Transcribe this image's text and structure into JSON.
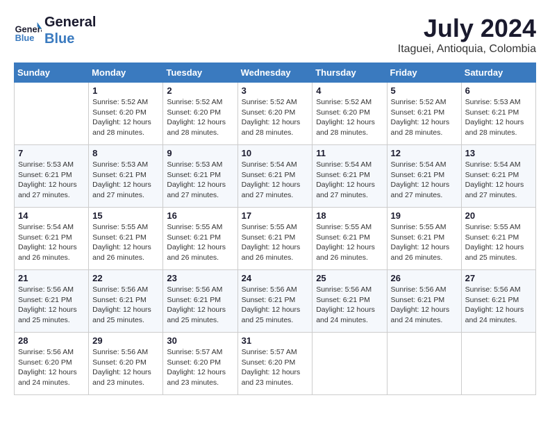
{
  "header": {
    "logo_line1": "General",
    "logo_line2": "Blue",
    "month_year": "July 2024",
    "location": "Itaguei, Antioquia, Colombia"
  },
  "days_of_week": [
    "Sunday",
    "Monday",
    "Tuesday",
    "Wednesday",
    "Thursday",
    "Friday",
    "Saturday"
  ],
  "weeks": [
    [
      {
        "day": "",
        "info": ""
      },
      {
        "day": "1",
        "info": "Sunrise: 5:52 AM\nSunset: 6:20 PM\nDaylight: 12 hours\nand 28 minutes."
      },
      {
        "day": "2",
        "info": "Sunrise: 5:52 AM\nSunset: 6:20 PM\nDaylight: 12 hours\nand 28 minutes."
      },
      {
        "day": "3",
        "info": "Sunrise: 5:52 AM\nSunset: 6:20 PM\nDaylight: 12 hours\nand 28 minutes."
      },
      {
        "day": "4",
        "info": "Sunrise: 5:52 AM\nSunset: 6:20 PM\nDaylight: 12 hours\nand 28 minutes."
      },
      {
        "day": "5",
        "info": "Sunrise: 5:52 AM\nSunset: 6:21 PM\nDaylight: 12 hours\nand 28 minutes."
      },
      {
        "day": "6",
        "info": "Sunrise: 5:53 AM\nSunset: 6:21 PM\nDaylight: 12 hours\nand 28 minutes."
      }
    ],
    [
      {
        "day": "7",
        "info": "Sunrise: 5:53 AM\nSunset: 6:21 PM\nDaylight: 12 hours\nand 27 minutes."
      },
      {
        "day": "8",
        "info": "Sunrise: 5:53 AM\nSunset: 6:21 PM\nDaylight: 12 hours\nand 27 minutes."
      },
      {
        "day": "9",
        "info": "Sunrise: 5:53 AM\nSunset: 6:21 PM\nDaylight: 12 hours\nand 27 minutes."
      },
      {
        "day": "10",
        "info": "Sunrise: 5:54 AM\nSunset: 6:21 PM\nDaylight: 12 hours\nand 27 minutes."
      },
      {
        "day": "11",
        "info": "Sunrise: 5:54 AM\nSunset: 6:21 PM\nDaylight: 12 hours\nand 27 minutes."
      },
      {
        "day": "12",
        "info": "Sunrise: 5:54 AM\nSunset: 6:21 PM\nDaylight: 12 hours\nand 27 minutes."
      },
      {
        "day": "13",
        "info": "Sunrise: 5:54 AM\nSunset: 6:21 PM\nDaylight: 12 hours\nand 27 minutes."
      }
    ],
    [
      {
        "day": "14",
        "info": "Sunrise: 5:54 AM\nSunset: 6:21 PM\nDaylight: 12 hours\nand 26 minutes."
      },
      {
        "day": "15",
        "info": "Sunrise: 5:55 AM\nSunset: 6:21 PM\nDaylight: 12 hours\nand 26 minutes."
      },
      {
        "day": "16",
        "info": "Sunrise: 5:55 AM\nSunset: 6:21 PM\nDaylight: 12 hours\nand 26 minutes."
      },
      {
        "day": "17",
        "info": "Sunrise: 5:55 AM\nSunset: 6:21 PM\nDaylight: 12 hours\nand 26 minutes."
      },
      {
        "day": "18",
        "info": "Sunrise: 5:55 AM\nSunset: 6:21 PM\nDaylight: 12 hours\nand 26 minutes."
      },
      {
        "day": "19",
        "info": "Sunrise: 5:55 AM\nSunset: 6:21 PM\nDaylight: 12 hours\nand 26 minutes."
      },
      {
        "day": "20",
        "info": "Sunrise: 5:55 AM\nSunset: 6:21 PM\nDaylight: 12 hours\nand 25 minutes."
      }
    ],
    [
      {
        "day": "21",
        "info": "Sunrise: 5:56 AM\nSunset: 6:21 PM\nDaylight: 12 hours\nand 25 minutes."
      },
      {
        "day": "22",
        "info": "Sunrise: 5:56 AM\nSunset: 6:21 PM\nDaylight: 12 hours\nand 25 minutes."
      },
      {
        "day": "23",
        "info": "Sunrise: 5:56 AM\nSunset: 6:21 PM\nDaylight: 12 hours\nand 25 minutes."
      },
      {
        "day": "24",
        "info": "Sunrise: 5:56 AM\nSunset: 6:21 PM\nDaylight: 12 hours\nand 25 minutes."
      },
      {
        "day": "25",
        "info": "Sunrise: 5:56 AM\nSunset: 6:21 PM\nDaylight: 12 hours\nand 24 minutes."
      },
      {
        "day": "26",
        "info": "Sunrise: 5:56 AM\nSunset: 6:21 PM\nDaylight: 12 hours\nand 24 minutes."
      },
      {
        "day": "27",
        "info": "Sunrise: 5:56 AM\nSunset: 6:21 PM\nDaylight: 12 hours\nand 24 minutes."
      }
    ],
    [
      {
        "day": "28",
        "info": "Sunrise: 5:56 AM\nSunset: 6:20 PM\nDaylight: 12 hours\nand 24 minutes."
      },
      {
        "day": "29",
        "info": "Sunrise: 5:56 AM\nSunset: 6:20 PM\nDaylight: 12 hours\nand 23 minutes."
      },
      {
        "day": "30",
        "info": "Sunrise: 5:57 AM\nSunset: 6:20 PM\nDaylight: 12 hours\nand 23 minutes."
      },
      {
        "day": "31",
        "info": "Sunrise: 5:57 AM\nSunset: 6:20 PM\nDaylight: 12 hours\nand 23 minutes."
      },
      {
        "day": "",
        "info": ""
      },
      {
        "day": "",
        "info": ""
      },
      {
        "day": "",
        "info": ""
      }
    ]
  ]
}
